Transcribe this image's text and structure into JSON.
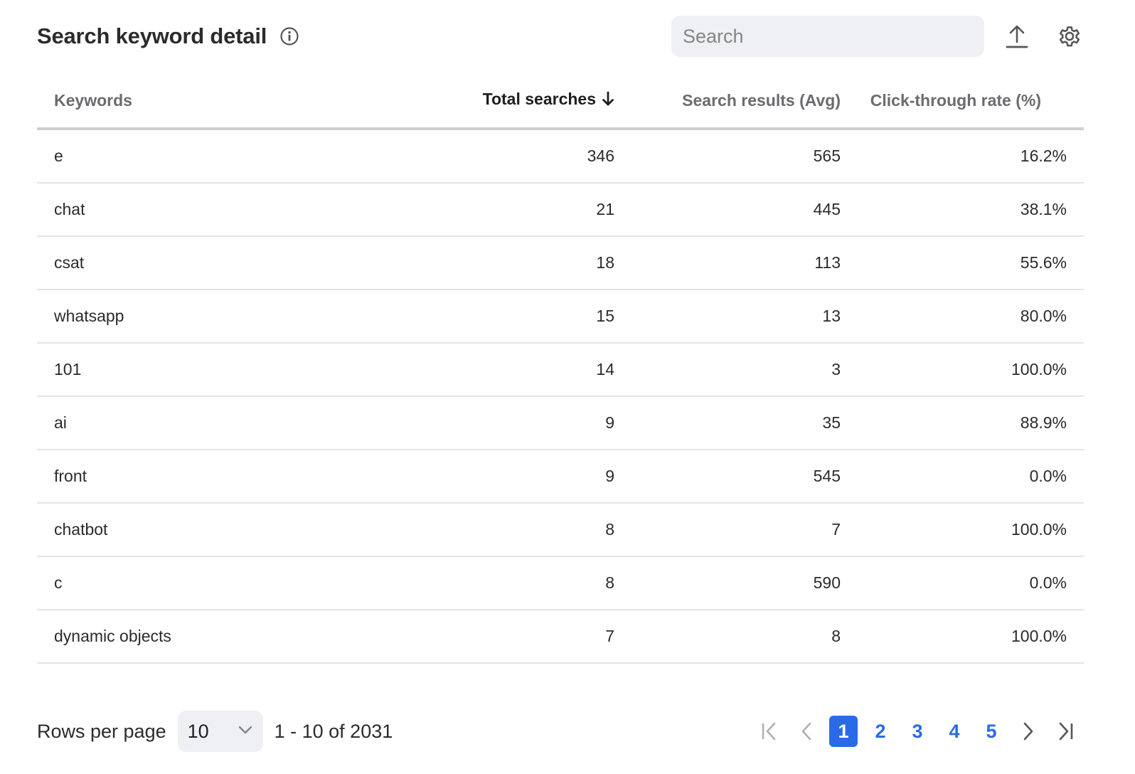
{
  "header": {
    "title": "Search keyword detail",
    "search_placeholder": "Search",
    "search_value": ""
  },
  "icons": {
    "info": "info-circle-icon",
    "export": "upload-icon",
    "settings": "gear-icon",
    "sort": "arrow-down-icon",
    "dropdown": "chevron-down-icon"
  },
  "table": {
    "columns": [
      {
        "label": "Keywords"
      },
      {
        "label": "Total searches",
        "sorted": "descending"
      },
      {
        "label": "Search results (Avg)"
      },
      {
        "label": "Click-through rate (%)"
      }
    ],
    "rows": [
      {
        "keyword": "e",
        "total": "346",
        "results": "565",
        "ctr": "16.2%"
      },
      {
        "keyword": "chat",
        "total": "21",
        "results": "445",
        "ctr": "38.1%"
      },
      {
        "keyword": "csat",
        "total": "18",
        "results": "113",
        "ctr": "55.6%"
      },
      {
        "keyword": "whatsapp",
        "total": "15",
        "results": "13",
        "ctr": "80.0%"
      },
      {
        "keyword": "101",
        "total": "14",
        "results": "3",
        "ctr": "100.0%"
      },
      {
        "keyword": "ai",
        "total": "9",
        "results": "35",
        "ctr": "88.9%"
      },
      {
        "keyword": "front",
        "total": "9",
        "results": "545",
        "ctr": "0.0%"
      },
      {
        "keyword": "chatbot",
        "total": "8",
        "results": "7",
        "ctr": "100.0%"
      },
      {
        "keyword": "c",
        "total": "8",
        "results": "590",
        "ctr": "0.0%"
      },
      {
        "keyword": "dynamic objects",
        "total": "7",
        "results": "8",
        "ctr": "100.0%"
      }
    ]
  },
  "footer": {
    "rows_per_page_label": "Rows per page",
    "rows_per_page_value": "10",
    "range_text": "1 - 10 of 2031",
    "pages": [
      "1",
      "2",
      "3",
      "4",
      "5"
    ],
    "current_page": "1"
  },
  "colors": {
    "accent": "#2b6ae6",
    "input_bg": "#eff0f4",
    "header_text": "#6b6b70",
    "divider": "#e4e4e8"
  }
}
